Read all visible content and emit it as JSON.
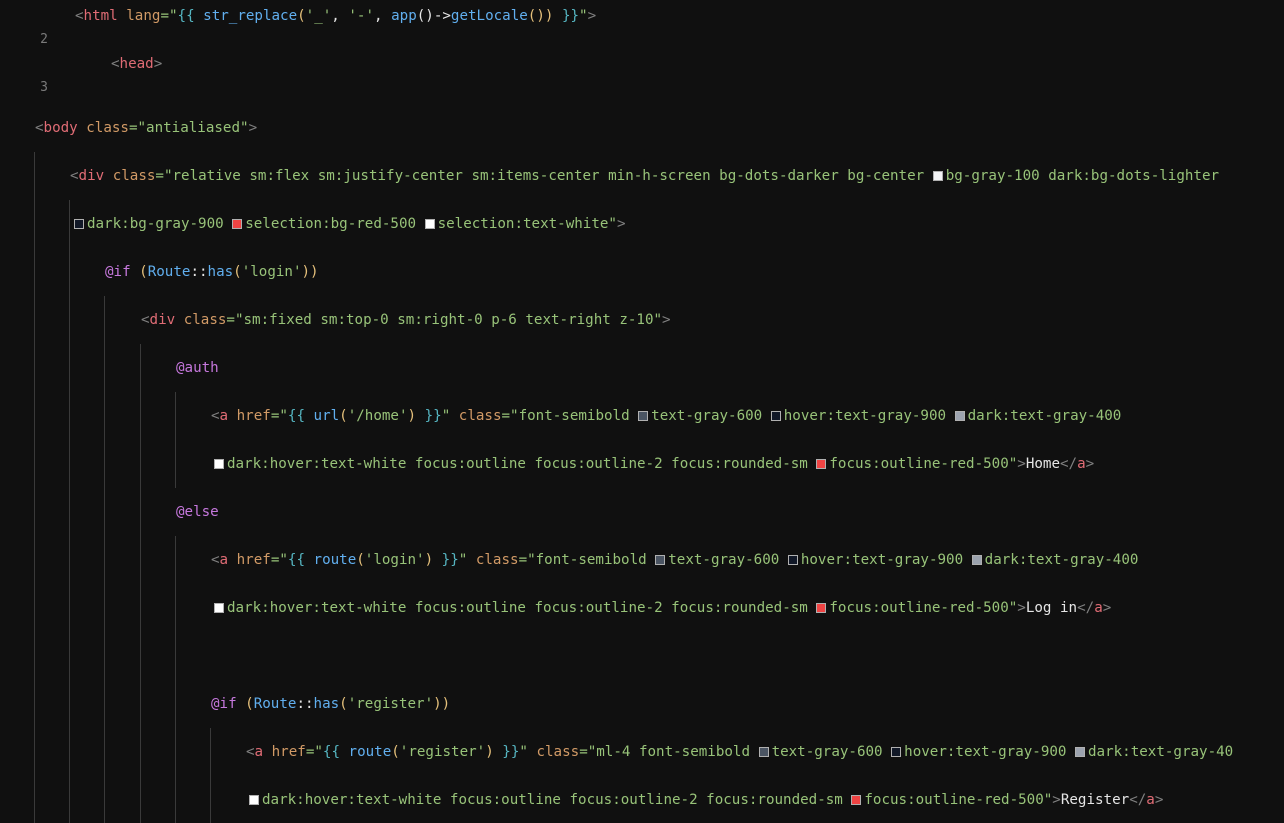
{
  "colors": {
    "editor_bg": "#101010",
    "gray_100": "#f3f4f6",
    "gray_900": "#111827",
    "gray_600": "#4b5563",
    "gray_400": "#9ca3af",
    "red_500": "#ef4444",
    "white": "#ffffff"
  },
  "lines": {
    "l2": {
      "num": "2",
      "t1": "<",
      "t2": "html",
      "t3": " lang",
      "t4": "=\"",
      "t5": "{{",
      "t6": " str_replace",
      "t7": "(",
      "t8": "'_'",
      "t9": ", ",
      "t10": "'-'",
      "t11": ", ",
      "t12": "app",
      "t13": "()->",
      "t14": "getLocale",
      "t15": "())",
      "t16": " }}",
      "t17": "\"",
      "t18": ">"
    },
    "l3": {
      "num": "3",
      "t1": "<",
      "t2": "head",
      "t3": ">"
    },
    "l4": {
      "t1": "<",
      "t2": "body",
      "t3": " class",
      "t4": "=\"antialiased\"",
      "t5": ">"
    },
    "l5": {
      "t1": "<",
      "t2": "div",
      "t3": " class",
      "t4": "=\"relative sm:flex sm:justify-center sm:items-center min-h-screen bg-dots-darker bg-center ",
      "t5": "bg-gray-100 dark:bg-dots-lighter"
    },
    "l6": {
      "t1": "dark:bg-gray-900 ",
      "t2": "selection:bg-red-500 ",
      "t3": "selection:text-white\"",
      "t4": ">"
    },
    "l7": {
      "t1": "@if",
      "t2": " (",
      "t3": "Route",
      "t4": "::",
      "t5": "has",
      "t6": "(",
      "t7": "'login'",
      "t8": "))"
    },
    "l8": {
      "t1": "<",
      "t2": "div",
      "t3": " class",
      "t4": "=\"sm:fixed sm:top-0 sm:right-0 p-6 text-right z-10\"",
      "t5": ">"
    },
    "l9": {
      "t1": "@auth"
    },
    "l10": {
      "t1": "<",
      "t2": "a",
      "t3": " href",
      "t4": "=\"",
      "t5": "{{",
      "t6": " url",
      "t7": "(",
      "t8": "'/home'",
      "t9": ")",
      "t10": " }}",
      "t11": "\"",
      "t12": " class",
      "t13": "=\"font-semibold ",
      "t14": "text-gray-600 ",
      "t15": "hover:text-gray-900 ",
      "t16": "dark:text-gray-400"
    },
    "l11": {
      "t1": "dark:hover:text-white focus:outline focus:outline-2 focus:rounded-sm ",
      "t2": "focus:outline-red-500\"",
      "t3": ">",
      "t4": "Home",
      "t5": "</",
      "t6": "a",
      "t7": ">"
    },
    "l12": {
      "t1": "@else"
    },
    "l13": {
      "t1": "<",
      "t2": "a",
      "t3": " href",
      "t4": "=\"",
      "t5": "{{",
      "t6": " route",
      "t7": "(",
      "t8": "'login'",
      "t9": ")",
      "t10": " }}",
      "t11": "\"",
      "t12": " class",
      "t13": "=\"font-semibold ",
      "t14": "text-gray-600 ",
      "t15": "hover:text-gray-900 ",
      "t16": "dark:text-gray-400"
    },
    "l14": {
      "t1": "dark:hover:text-white focus:outline focus:outline-2 focus:rounded-sm ",
      "t2": "focus:outline-red-500\"",
      "t3": ">",
      "t4": "Log in",
      "t5": "</",
      "t6": "a",
      "t7": ">"
    },
    "l16": {
      "t1": "@if",
      "t2": " (",
      "t3": "Route",
      "t4": "::",
      "t5": "has",
      "t6": "(",
      "t7": "'register'",
      "t8": "))"
    },
    "l17": {
      "t1": "<",
      "t2": "a",
      "t3": " href",
      "t4": "=\"",
      "t5": "{{",
      "t6": " route",
      "t7": "(",
      "t8": "'register'",
      "t9": ")",
      "t10": " }}",
      "t11": "\"",
      "t12": " class",
      "t13": "=\"ml-4 font-semibold ",
      "t14": "text-gray-600 ",
      "t15": "hover:text-gray-900 ",
      "t16": "dark:text-gray-40"
    },
    "l18": {
      "t1": "dark:hover:text-white focus:outline focus:outline-2 focus:rounded-sm ",
      "t2": "focus:outline-red-500\"",
      "t3": ">",
      "t4": "Register",
      "t5": "</",
      "t6": "a",
      "t7": ">"
    }
  }
}
